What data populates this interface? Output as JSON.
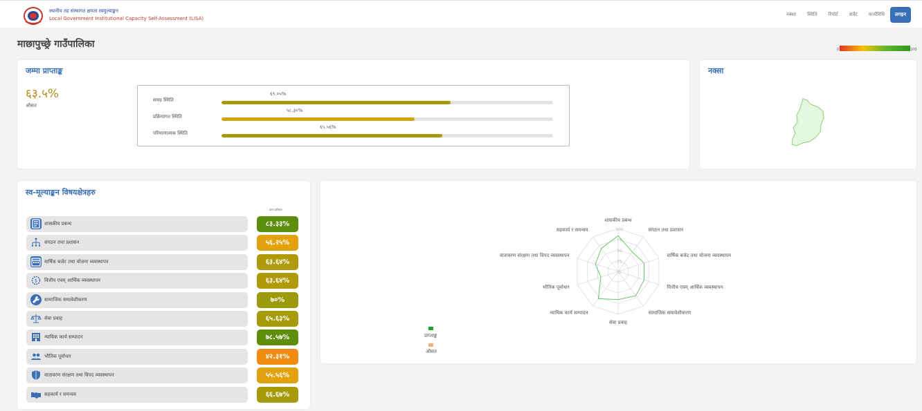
{
  "header": {
    "brand_line1": "स्थानीय तह संस्थागत क्षमता स्वमूल्याङ्कन",
    "brand_line2": "Local Government Institutional Capacity Self-Assessment (LISA)",
    "nav": [
      "नक्सा",
      "स्थिति",
      "रिपोर्ट",
      "सर्वेट",
      "कार्यविधि",
      "लगइन"
    ],
    "active_nav": "लगइन"
  },
  "page_title": "माछापुच्छ्रे गाउँपालिका",
  "legend": {
    "min": "0",
    "max": "100",
    "colors": [
      "#e53222",
      "#f5c000",
      "#5bb52f",
      "#2e9a1f"
    ]
  },
  "total_card": {
    "title": "जम्मा प्राप्ताङ्क",
    "score": "६३.५%",
    "avg_label": "औसत",
    "bars": [
      {
        "label": "समग्र स्थिति",
        "pct": "६९.०५%",
        "value": 69.05,
        "color": "#a89a06"
      },
      {
        "label": "प्रक्रियागत स्थिति",
        "pct": "५८.३०%",
        "value": 58.3,
        "color": "#d1a60b"
      },
      {
        "label": "परिमाणात्मक स्थिति",
        "pct": "६५.५६%",
        "value": 66.56,
        "color": "#a89a06"
      }
    ]
  },
  "map_card": {
    "title": "नक्सा"
  },
  "areas_card": {
    "title": "स्व-मूल्याङ्कन विषयक्षेत्रहरु",
    "col_head": "प्राप्त प्रतिशत",
    "items": [
      {
        "label": "शासकीय प्रबन्ध",
        "score": "८३.३३%",
        "color": "#5a8e0c",
        "icon": "document-list-icon"
      },
      {
        "label": "संगठन तथा प्रशासन",
        "score": "५६.२५%",
        "color": "#e2a10e",
        "icon": "org-chart-icon"
      },
      {
        "label": "वार्षिक बजेट तथा योजना व्यवस्थापन",
        "score": "६३.६४%",
        "color": "#b09a0a",
        "icon": "calendar-icon"
      },
      {
        "label": "वित्तीय एवम् आर्थिक व्यवस्थापन",
        "score": "६३.६४%",
        "color": "#b09a0a",
        "icon": "finance-gear-icon"
      },
      {
        "label": "सामाजिक समावेशीकरण",
        "score": "७०%",
        "color": "#9a9a0a",
        "icon": "wrench-icon"
      },
      {
        "label": "सेवा प्रवाह",
        "score": "६५.६३%",
        "color": "#a89a06",
        "icon": "scales-icon"
      },
      {
        "label": "न्यायिक कार्य सम्पादन",
        "score": "७८.५७%",
        "color": "#5f8e0c",
        "icon": "building-icon"
      },
      {
        "label": "भौतिक पूर्वाधार",
        "score": "४२.३१%",
        "color": "#f08a10",
        "icon": "people-icon"
      },
      {
        "label": "वातावरण संरक्षण तथा विपद व्यवस्थापन",
        "score": "५५.५६%",
        "color": "#e2a10e",
        "icon": "shield-icon"
      },
      {
        "label": "सहकार्य र समन्वय",
        "score": "६६.६७%",
        "color": "#a89a06",
        "icon": "handshake-icon"
      }
    ]
  },
  "radar_card": {
    "axes": [
      "शासकीय प्रबन्ध",
      "संगठन तथा प्रशासन",
      "वार्षिक बजेट तथा योजना व्यवस्थापन",
      "वित्तीय एवम् आर्थिक व्यवस्थापन",
      "सामाजिक समावेशीकरण",
      "सेवा प्रवाह",
      "न्यायिक कार्य सम्पादन",
      "भौतिक पूर्वाधार",
      "वातावरण संरक्षण तथा विपद व्यवस्थापन",
      "सहकार्य र समन्वय"
    ],
    "tick_labels": [
      "0",
      "25",
      "50",
      "75",
      "100"
    ],
    "legend": [
      {
        "name": "प्राप्ताङ्क",
        "color": "#1fa02a"
      },
      {
        "name": "औसत",
        "color": "#f5b07a"
      }
    ],
    "line_color": "#6cc36a"
  },
  "chart_data": {
    "type": "radar",
    "categories": [
      "शासकीय प्रबन्ध",
      "संगठन तथा प्रशासन",
      "वार्षिक बजेट तथा योजना व्यवस्थापन",
      "वित्तीय एवम् आर्थिक व्यवस्थापन",
      "सामाजिक समावेशीकरण",
      "सेवा प्रवाह",
      "न्यायिक कार्य सम्पादन",
      "भौतिक पूर्वाधार",
      "वातावरण संरक्षण तथा विपद व्यवस्थापन",
      "सहकार्य र समन्वय"
    ],
    "series": [
      {
        "name": "प्राप्ताङ्क",
        "values": [
          83.33,
          56.25,
          63.64,
          63.64,
          70,
          65.63,
          78.57,
          42.31,
          55.56,
          66.67
        ]
      }
    ],
    "rlim": [
      0,
      100
    ],
    "legend": "bottom-left"
  }
}
